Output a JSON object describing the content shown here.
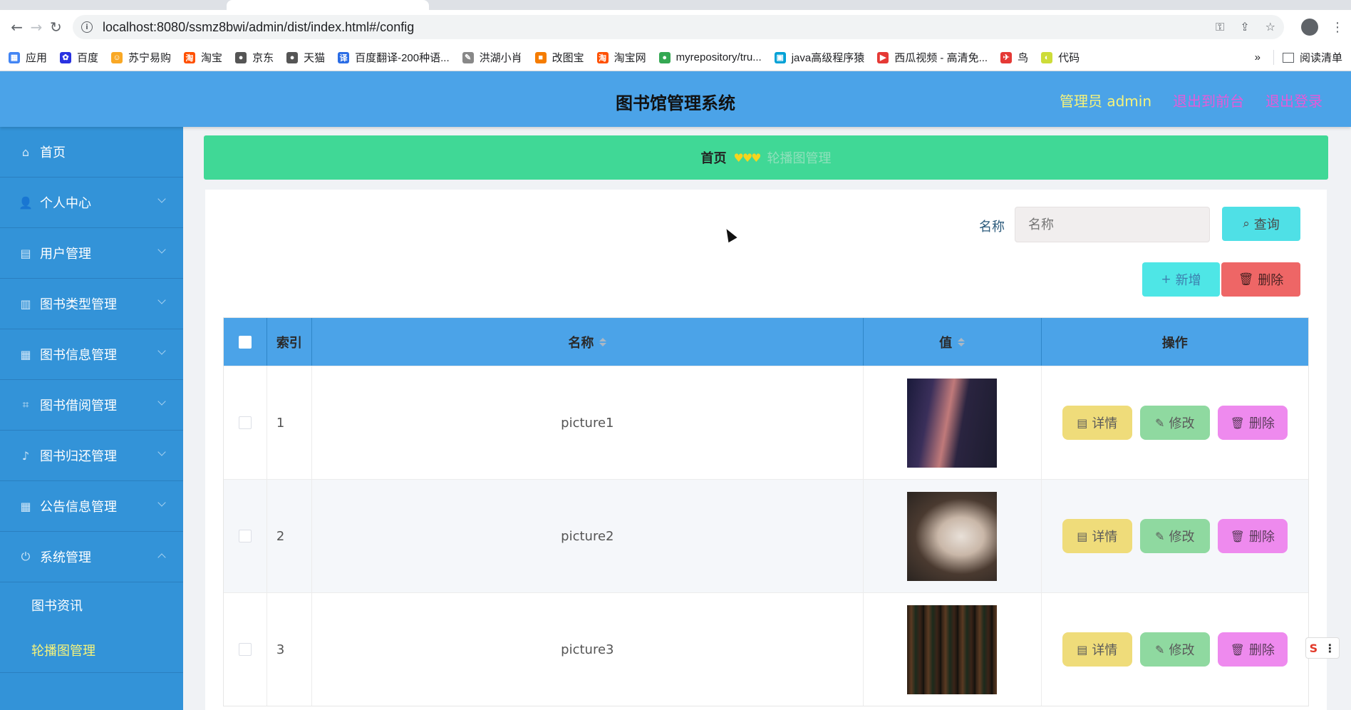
{
  "browser": {
    "url_host": "localhost",
    "url_rest": ":8080/ssmz8bwi/admin/dist/index.html#/config",
    "bookmarks": [
      {
        "label": "应用",
        "color": "#4285f4",
        "glyph": "▦"
      },
      {
        "label": "百度",
        "color": "#2932e1",
        "glyph": "✿"
      },
      {
        "label": "苏宁易购",
        "color": "#f9a825",
        "glyph": "☺"
      },
      {
        "label": "淘宝",
        "color": "#ff5000",
        "glyph": "淘"
      },
      {
        "label": "京东",
        "color": "#555555",
        "glyph": "●"
      },
      {
        "label": "天猫",
        "color": "#555555",
        "glyph": "●"
      },
      {
        "label": "百度翻译-200种语...",
        "color": "#2b6de5",
        "glyph": "译"
      },
      {
        "label": "洪湖小肖",
        "color": "#888888",
        "glyph": "✎"
      },
      {
        "label": "改图宝",
        "color": "#f57c00",
        "glyph": "■"
      },
      {
        "label": "淘宝网",
        "color": "#ff5000",
        "glyph": "淘"
      },
      {
        "label": "myrepository/tru...",
        "color": "#34a853",
        "glyph": "●"
      },
      {
        "label": "java高级程序猿",
        "color": "#00a1d6",
        "glyph": "▣"
      },
      {
        "label": "西瓜视频 - 高清免...",
        "color": "#e53935",
        "glyph": "▶"
      },
      {
        "label": "鸟",
        "color": "#e53935",
        "glyph": "✈"
      },
      {
        "label": "代码",
        "color": "#cddc39",
        "glyph": "◐"
      }
    ],
    "more_glyph": "»",
    "reading_list": "阅读清单"
  },
  "header": {
    "title": "图书馆管理系统",
    "admin_label": "管理员 admin",
    "front_link": "退出到前台",
    "logout_link": "退出登录"
  },
  "sidebar": {
    "items": [
      {
        "label": "首页",
        "icon": "home-icon",
        "glyph": "⌂"
      },
      {
        "label": "个人中心",
        "icon": "user-icon",
        "glyph": "👤"
      },
      {
        "label": "用户管理",
        "icon": "clipboard-icon",
        "glyph": "▤"
      },
      {
        "label": "图书类型管理",
        "icon": "bar-chart-icon",
        "glyph": "▥"
      },
      {
        "label": "图书信息管理",
        "icon": "grid-icon",
        "glyph": "▦"
      },
      {
        "label": "图书借阅管理",
        "icon": "crop-icon",
        "glyph": "⌗"
      },
      {
        "label": "图书归还管理",
        "icon": "microphone-icon",
        "glyph": "♪"
      },
      {
        "label": "公告信息管理",
        "icon": "apps-icon",
        "glyph": "▦"
      },
      {
        "label": "系统管理",
        "icon": "power-icon",
        "glyph": "⏻"
      }
    ],
    "sub_items": [
      {
        "label": "图书资讯"
      },
      {
        "label": "轮播图管理"
      }
    ]
  },
  "breadcrumb": {
    "home": "首页",
    "separator": "♥♥♥",
    "current": "轮播图管理"
  },
  "search": {
    "label": "名称",
    "placeholder": "名称",
    "button_label": "查询"
  },
  "actions": {
    "add_label": "新增",
    "delete_label": "删除"
  },
  "table": {
    "columns": {
      "index": "索引",
      "name": "名称",
      "value": "值",
      "ops": "操作"
    },
    "rows": [
      {
        "index": "1",
        "name": "picture1"
      },
      {
        "index": "2",
        "name": "picture2"
      },
      {
        "index": "3",
        "name": "picture3"
      }
    ],
    "op_labels": {
      "detail": "详情",
      "edit": "修改",
      "delete": "删除"
    }
  },
  "colors": {
    "header_bg": "#4ba3e8",
    "sidebar_bg": "#3393d8",
    "breadcrumb_bg": "#40d896",
    "accent_yellow": "#f6f37a",
    "accent_pink": "#e65ad9"
  }
}
